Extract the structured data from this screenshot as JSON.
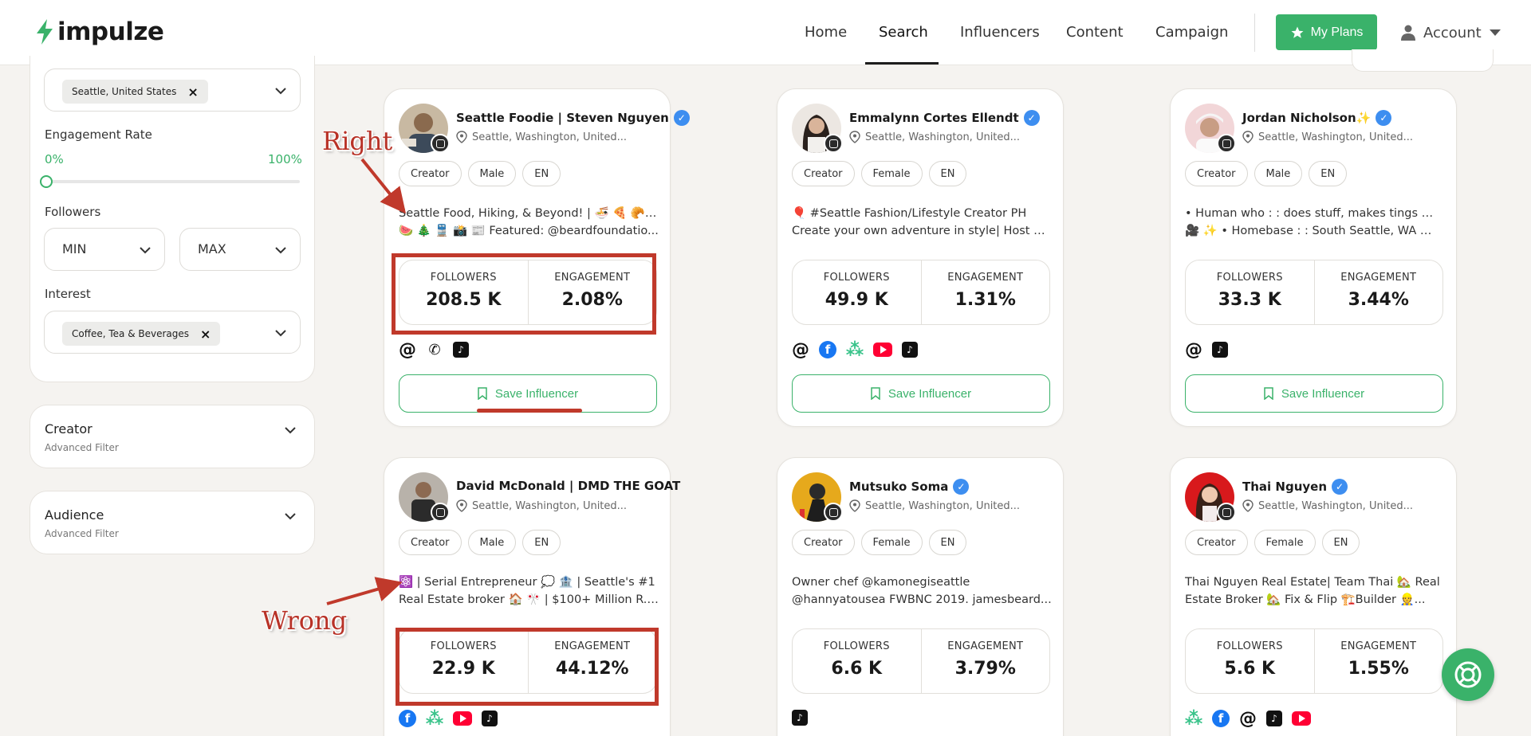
{
  "header": {
    "brand": "impulze",
    "nav": [
      "Home",
      "Search",
      "Influencers",
      "Content",
      "Campaign"
    ],
    "active_nav": "Search",
    "my_plans": "My Plans",
    "account": "Account",
    "accent": "#3ab26a"
  },
  "filters": {
    "location_tag": "Seattle, United States",
    "engagement_label": "Engagement Rate",
    "engagement_min": "0%",
    "engagement_max": "100%",
    "followers_label": "Followers",
    "followers_min": "MIN",
    "followers_max": "MAX",
    "interest_label": "Interest",
    "interest_tag": "Coffee, Tea & Beverages",
    "creator_title": "Creator",
    "creator_sub": "Advanced Filter",
    "audience_title": "Audience",
    "audience_sub": "Advanced Filter"
  },
  "labels": {
    "followers": "FOLLOWERS",
    "engagement": "ENGAGEMENT",
    "save": "Save Influencer"
  },
  "cards": [
    {
      "name": "Seattle Foodie | Steven Nguyen",
      "location": "Seattle, Washington, United...",
      "tags": [
        "Creator",
        "Male",
        "EN"
      ],
      "bio1": "Seattle Food, Hiking, & Beyond! | 🍜 🍕 🥐 🍝",
      "bio2": "🍉 🎄 🚆 📸 📰 Featured: @beardfoundatio...",
      "followers": "208.5 K",
      "engagement": "2.08%"
    },
    {
      "name": "Emmalynn Cortes Ellendt",
      "location": "Seattle, Washington, United...",
      "tags": [
        "Creator",
        "Female",
        "EN"
      ],
      "bio1": "🎈 #Seattle Fashion/Lifestyle Creator PH",
      "bio2": "Create your own adventure in style| Host of...",
      "followers": "49.9 K",
      "engagement": "1.31%"
    },
    {
      "name": "Jordan Nicholson✨",
      "location": "Seattle, Washington, United...",
      "tags": [
        "Creator",
        "Male",
        "EN"
      ],
      "bio1": "• Human who : : does stuff, makes tings 📷 🎨",
      "bio2": "🎥 ✨ • Homebase : : South Seattle, WA ☂️...",
      "followers": "33.3 K",
      "engagement": "3.44%"
    },
    {
      "name": "David McDonald | DMD THE GOAT",
      "location": "Seattle, Washington, United...",
      "tags": [
        "Creator",
        "Male",
        "EN"
      ],
      "bio1": "⚛️ | Serial Entrepreneur 💭 🏦 | Seattle's #1",
      "bio2": "Real Estate broker 🏠 🎌 | $100+ Million R.E...",
      "followers": "22.9 K",
      "engagement": "44.12%"
    },
    {
      "name": "Mutsuko Soma",
      "location": "Seattle, Washington, United...",
      "tags": [
        "Creator",
        "Female",
        "EN"
      ],
      "bio1": "Owner chef @kamonegiseattle",
      "bio2": "@hannyatousea FWBNC 2019. jamesbeard...",
      "followers": "6.6 K",
      "engagement": "3.79%"
    },
    {
      "name": "Thai Nguyen",
      "location": "Seattle, Washington, United...",
      "tags": [
        "Creator",
        "Female",
        "EN"
      ],
      "bio1": "Thai Nguyen Real Estate| Team Thai 🏡 Real",
      "bio2": "Estate Broker 🏡 Fix & Flip 🏗️Builder 👷...",
      "followers": "5.6 K",
      "engagement": "1.55%"
    }
  ],
  "annotations": {
    "right": "Right",
    "wrong": "Wrong",
    "color": "#c0392b"
  },
  "icons": [
    "instagram-icon",
    "location-pin-icon",
    "verified-icon",
    "at-icon",
    "phone-icon",
    "tiktok-icon",
    "facebook-icon",
    "linktree-icon",
    "youtube-icon",
    "bookmark-icon",
    "star-icon",
    "user-icon",
    "lifebuoy-icon",
    "chevron-down-icon"
  ]
}
